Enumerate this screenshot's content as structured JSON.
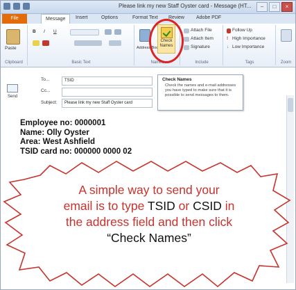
{
  "window": {
    "title": "Please link my new Staff Oyster card - Message (HT...",
    "controls": [
      "minimize",
      "maximize",
      "close"
    ]
  },
  "tabs": [
    "File",
    "Message",
    "Insert",
    "Options",
    "Format Text",
    "Review",
    "Adobe PDF"
  ],
  "ribbon": {
    "clipboard": {
      "label": "Clipboard",
      "paste": "Paste"
    },
    "basic_text": {
      "label": "Basic Text"
    },
    "names": {
      "label": "Names",
      "address_book": "Address Book",
      "check_names": "Check Names"
    },
    "include": {
      "label": "Include",
      "attach_file": "Attach File",
      "attach_item": "Attach Item",
      "signature": "Signature"
    },
    "tags": {
      "label": "Tags",
      "follow_up": "Follow Up",
      "high_importance": "High Importance",
      "low_importance": "Low Importance"
    },
    "zoom": {
      "label": "Zoom"
    }
  },
  "tooltip": {
    "title": "Check Names",
    "body": "Check the names and e-mail addresses you have typed to make sure that it is possible to send messages to them."
  },
  "header": {
    "send": "Send",
    "to_label": "To...",
    "to_value": "TSID",
    "cc_label": "Cc...",
    "subject_label": "Subject:",
    "subject_value": "Please link my new Staff Oyster card"
  },
  "body_lines": [
    "Employee no: 0000001",
    "Name: Olly Oyster",
    "Area: West Ashfield",
    "TSID card no: 000000 0000 02"
  ],
  "callout": {
    "line1": "A simple way to send your",
    "line2a": "email is to type ",
    "tsid": "TSID",
    "or": " or ",
    "csid": "CSID",
    "line2b": " in",
    "line3": "the address field and then click",
    "quote_open": "“",
    "check_names": "Check Names",
    "quote_close": "”"
  },
  "colors": {
    "file_tab": "#e36c0a",
    "callout_text": "#c8322c",
    "highlight": "#d22222"
  }
}
